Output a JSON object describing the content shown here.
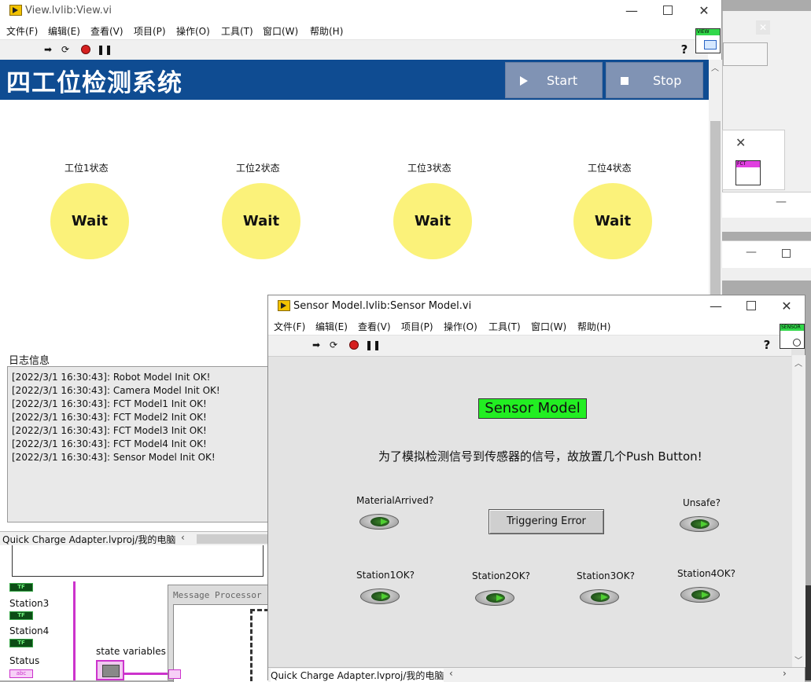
{
  "view_window": {
    "title": "View.lvlib:View.vi",
    "menu": [
      "文件(F)",
      "编辑(E)",
      "查看(V)",
      "项目(P)",
      "操作(O)",
      "工具(T)",
      "窗口(W)",
      "帮助(H)"
    ],
    "icon_text": "VIEW",
    "header_title": "四工位检测系统",
    "start_label": "Start",
    "stop_label": "Stop",
    "stations": [
      {
        "label": "工位1状态",
        "status": "Wait"
      },
      {
        "label": "工位2状态",
        "status": "Wait"
      },
      {
        "label": "工位3状态",
        "status": "Wait"
      },
      {
        "label": "工位4状态",
        "status": "Wait"
      }
    ],
    "log_label": "日志信息",
    "log_lines": [
      "[2022/3/1 16:30:43]: Robot Model Init OK!",
      "[2022/3/1 16:30:43]: Camera Model Init OK!",
      "[2022/3/1 16:30:43]: FCT Model1 Init OK!",
      "[2022/3/1 16:30:43]: FCT Model2 Init OK!",
      "[2022/3/1 16:30:43]: FCT Model3 Init OK!",
      "[2022/3/1 16:30:43]: FCT Model4 Init OK!",
      "[2022/3/1 16:30:43]: Sensor Model Init OK!"
    ],
    "status_path": "Quick Charge Adapter.lvproj/我的电脑"
  },
  "back_window": {
    "fct_icon_text": "FCT"
  },
  "block_diagram": {
    "station3": "Station3",
    "station4": "Station4",
    "status": "Status",
    "state_variables": "state variables",
    "message_processor": "Message Processor",
    "tf": "TF",
    "abc": "abc"
  },
  "sensor_window": {
    "title": "Sensor Model.lvlib:Sensor Model.vi",
    "menu": [
      "文件(F)",
      "编辑(E)",
      "查看(V)",
      "项目(P)",
      "操作(O)",
      "工具(T)",
      "窗口(W)",
      "帮助(H)"
    ],
    "icon_text": "SENSOR",
    "heading": "Sensor Model",
    "description": "为了模拟检测信号到传感器的信号，故放置几个Push Button!",
    "material_arrived": "MaterialArrived?",
    "unsafe": "Unsafe?",
    "triggering_error": "Triggering Error",
    "station1": "Station1OK?",
    "station2": "Station2OK?",
    "station3": "Station3OK?",
    "station4": "Station4OK?",
    "status_path": "Quick Charge Adapter.lvproj/我的电脑"
  },
  "colors": {
    "header_bg": "#0f4c92",
    "header_btn": "#8093b4",
    "status_circle": "#fbf27a",
    "sensor_heading_bg": "#22ee22",
    "diagram_wire": "#cc33cc"
  }
}
